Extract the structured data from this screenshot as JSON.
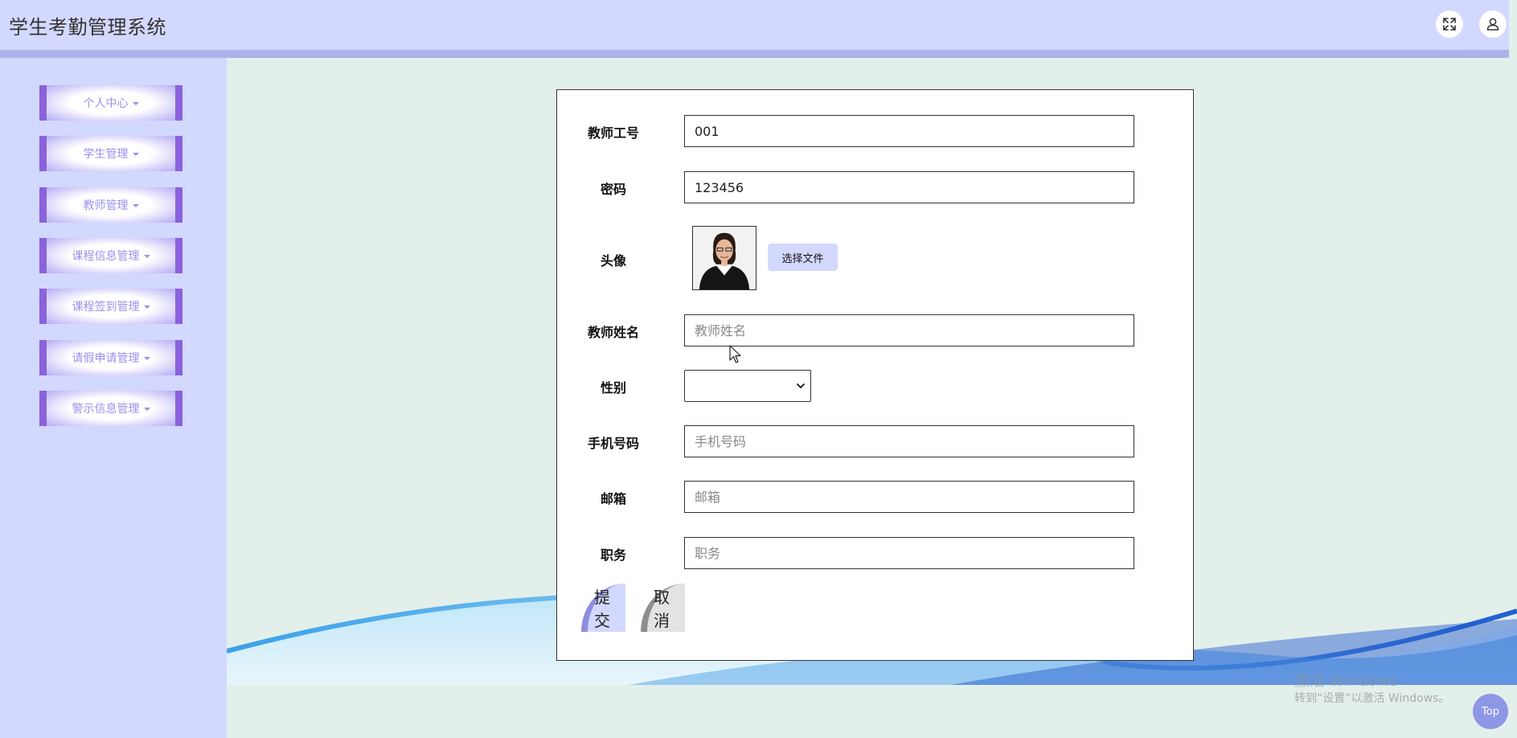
{
  "header": {
    "title": "学生考勤管理系统",
    "fullscreen_icon": "fullscreen-icon",
    "user_icon": "user-icon"
  },
  "sidebar": {
    "items": [
      {
        "label": "个人中心"
      },
      {
        "label": "学生管理"
      },
      {
        "label": "教师管理"
      },
      {
        "label": "课程信息管理"
      },
      {
        "label": "课程签到管理"
      },
      {
        "label": "请假申请管理"
      },
      {
        "label": "警示信息管理"
      }
    ]
  },
  "form": {
    "teacher_id": {
      "label": "教师工号",
      "value": "001"
    },
    "password": {
      "label": "密码",
      "value": "123456"
    },
    "avatar": {
      "label": "头像",
      "file_button": "选择文件"
    },
    "teacher_name": {
      "label": "教师姓名",
      "value": "",
      "placeholder": "教师姓名"
    },
    "gender": {
      "label": "性别",
      "value": ""
    },
    "phone": {
      "label": "手机号码",
      "value": "",
      "placeholder": "手机号码"
    },
    "email": {
      "label": "邮箱",
      "value": "",
      "placeholder": "邮箱"
    },
    "position": {
      "label": "职务",
      "value": "",
      "placeholder": "职务"
    },
    "submit_label": "提交",
    "cancel_label": "取消"
  },
  "watermark": {
    "line1": "激活 Windows",
    "line2": "转到“设置”以激活 Windows。"
  },
  "top_button": {
    "label": "Top"
  },
  "colors": {
    "header_bg": "#d3d8fe",
    "sidebar_bg": "#d3d8fe",
    "menu_border": "#8a62dd",
    "menu_text": "#9a90ef",
    "page_bg": "#e3efeb"
  }
}
